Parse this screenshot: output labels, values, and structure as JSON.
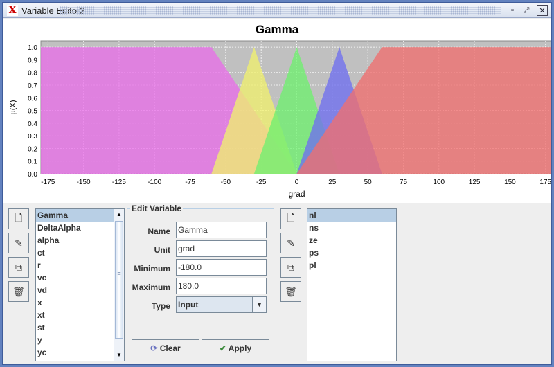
{
  "window": {
    "title": "Variable Editor2",
    "icon": "fuzzy-app-icon",
    "controls": [
      "minimize-icon",
      "maximize-icon",
      "close-icon"
    ]
  },
  "chart_data": {
    "type": "area",
    "title": "Gamma",
    "xlabel": "grad",
    "ylabel": "µ(X)",
    "xlim": [
      -180,
      180
    ],
    "ylim": [
      0,
      1.05
    ],
    "xticks": [
      -175,
      -150,
      -125,
      -100,
      -75,
      -50,
      -25,
      0,
      25,
      50,
      75,
      100,
      125,
      150,
      175
    ],
    "yticks": [
      "0.0",
      "0.1",
      "0.2",
      "0.3",
      "0.4",
      "0.5",
      "0.6",
      "0.7",
      "0.8",
      "0.9",
      "1.0"
    ],
    "grid": true,
    "background": "#c0c0c0",
    "series": [
      {
        "name": "nl",
        "color": "#e870e8",
        "points": [
          [
            -180,
            0
          ],
          [
            -180,
            1
          ],
          [
            -60,
            1
          ],
          [
            0,
            0
          ]
        ]
      },
      {
        "name": "ns",
        "color": "#f0f070",
        "points": [
          [
            -60,
            0
          ],
          [
            -30,
            1
          ],
          [
            0,
            0
          ]
        ]
      },
      {
        "name": "ze",
        "color": "#70f070",
        "points": [
          [
            -30,
            0
          ],
          [
            0,
            1
          ],
          [
            30,
            0
          ]
        ]
      },
      {
        "name": "ps",
        "color": "#7070f0",
        "points": [
          [
            0,
            0
          ],
          [
            30,
            1
          ],
          [
            60,
            0
          ]
        ]
      },
      {
        "name": "pl",
        "color": "#f07070",
        "points": [
          [
            0,
            0
          ],
          [
            60,
            1
          ],
          [
            180,
            1
          ],
          [
            180,
            0
          ]
        ]
      }
    ]
  },
  "variables": {
    "items": [
      "Gamma",
      "DeltaAlpha",
      "alpha",
      "ct",
      "r",
      "vc",
      "vd",
      "x",
      "xt",
      "st",
      "y",
      "yc"
    ],
    "selected": "Gamma"
  },
  "edit": {
    "title": "Edit Variable",
    "name_label": "Name",
    "name_value": "Gamma",
    "unit_label": "Unit",
    "unit_value": "grad",
    "min_label": "Minimum",
    "min_value": "-180.0",
    "max_label": "Maximum",
    "max_value": "180.0",
    "type_label": "Type",
    "type_value": "Input",
    "clear": "Clear",
    "apply": "Apply"
  },
  "terms": {
    "items": [
      "nl",
      "ns",
      "ze",
      "ps",
      "pl"
    ],
    "selected": "nl"
  }
}
